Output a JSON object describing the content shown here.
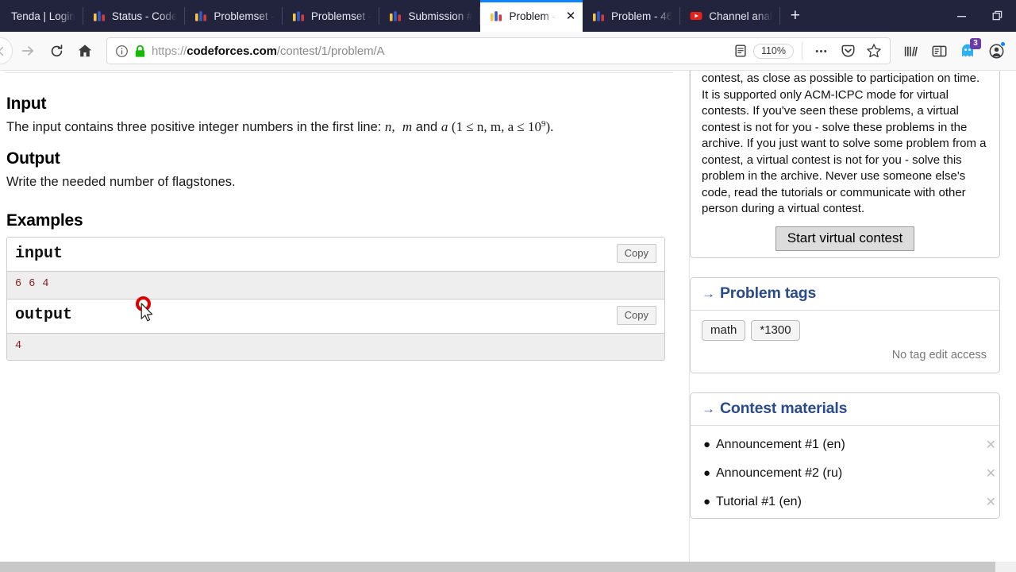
{
  "browser": {
    "tabs": [
      {
        "title": "Tenda | Login",
        "icon": "none",
        "active": false
      },
      {
        "title": "Status - Code",
        "icon": "codeforces-icon",
        "active": false
      },
      {
        "title": "Problemset -",
        "icon": "codeforces-icon",
        "active": false
      },
      {
        "title": "Problemset -",
        "icon": "codeforces-icon",
        "active": false
      },
      {
        "title": "Submission #",
        "icon": "codeforces-icon",
        "active": false
      },
      {
        "title": "Problem -",
        "icon": "codeforces-icon",
        "active": true
      },
      {
        "title": "Problem - 46",
        "icon": "codeforces-icon",
        "active": false
      },
      {
        "title": "Channel anal",
        "icon": "youtube-icon",
        "active": false
      }
    ],
    "new_tab_label": "+",
    "minimize_label": "–",
    "restore_label": "❐",
    "close_tab_label": "✕",
    "url": {
      "scheme": "https://",
      "host": "codeforces.com",
      "path": "/contest/1/problem/A"
    },
    "zoom_level": "110%",
    "container_badge_count": "3",
    "accent_color": "#0a84ff",
    "tabbar_color": "#22243d"
  },
  "content": {
    "cut_top_line": " ",
    "input_heading": "Input",
    "input_text_pre": "The input contains three positive integer numbers in the first line: ",
    "input_var_n": "n,",
    "input_var_m": "m",
    "input_and": " and ",
    "input_var_a": "a",
    "input_constraint_open": "(1 ≤ n, m, a ≤ 10",
    "input_constraint_sup": "9",
    "input_constraint_close": ").",
    "output_heading": "Output",
    "output_text": "Write the needed number of flagstones.",
    "examples_heading": "Examples",
    "samples": [
      {
        "label": "input",
        "copy_label": "Copy",
        "value": "6 6 4"
      },
      {
        "label": "output",
        "copy_label": "Copy",
        "value": "4"
      }
    ]
  },
  "sidebar": {
    "virtual_contest": {
      "text": "contest, as close as possible to participation on time. It is supported only ACM-ICPC mode for virtual contests. If you've seen these problems, a virtual contest is not for you - solve these problems in the archive. If you just want to solve some problem from a contest, a virtual contest is not for you - solve this problem in the archive. Never use someone else's code, read the tutorials or communicate with other person during a virtual contest.",
      "button_label": "Start virtual contest"
    },
    "problem_tags": {
      "arrow": "→",
      "title": "Problem tags",
      "tags": [
        "math",
        "*1300"
      ],
      "no_edit_text": "No tag edit access"
    },
    "contest_materials": {
      "arrow": "→",
      "title": "Contest materials",
      "items": [
        {
          "label": "Announcement #1 (en)",
          "remove": "✕"
        },
        {
          "label": "Announcement #2 (ru)",
          "remove": "✕"
        },
        {
          "label": "Tutorial #1 (en)",
          "remove": "✕"
        }
      ]
    },
    "heading_color": "#2a4b8d"
  }
}
